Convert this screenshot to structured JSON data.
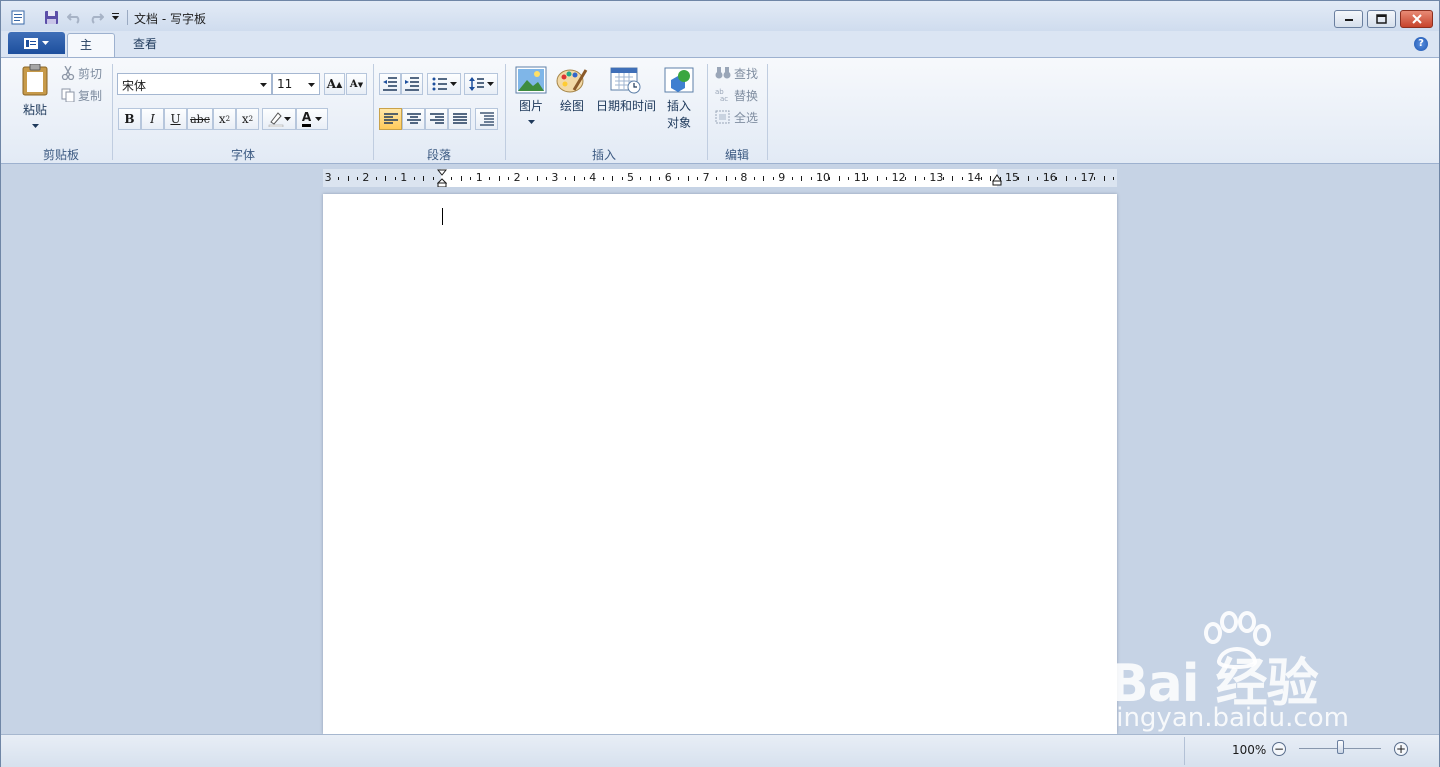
{
  "window": {
    "title": "文档 - 写字板"
  },
  "tabs": {
    "home": "主页",
    "view": "查看"
  },
  "clipboard": {
    "paste": "粘贴",
    "cut": "剪切",
    "copy": "复制",
    "label": "剪贴板"
  },
  "font": {
    "name": "宋体",
    "size": "11",
    "label": "字体"
  },
  "paragraph": {
    "label": "段落"
  },
  "insert": {
    "picture": "图片",
    "paint": "绘图",
    "datetime": "日期和时间",
    "object_line1": "插入",
    "object_line2": "对象",
    "label": "插入"
  },
  "edit": {
    "find": "查找",
    "replace": "替换",
    "select_all": "全选",
    "label": "编辑"
  },
  "ruler": {
    "ticks": [
      "3",
      "2",
      "1",
      "1",
      "2",
      "3",
      "4",
      "5",
      "6",
      "7",
      "8",
      "9",
      "10",
      "11",
      "12",
      "13",
      "14",
      "15",
      "16",
      "17"
    ]
  },
  "status": {
    "zoom": "100%"
  },
  "watermark": {
    "brand": "Bai 经验",
    "url": "jingyan.baidu.com"
  },
  "colors": {
    "accent": "#1d4f9d",
    "highlight": "#ffcb5a",
    "font_color": "#000000"
  }
}
